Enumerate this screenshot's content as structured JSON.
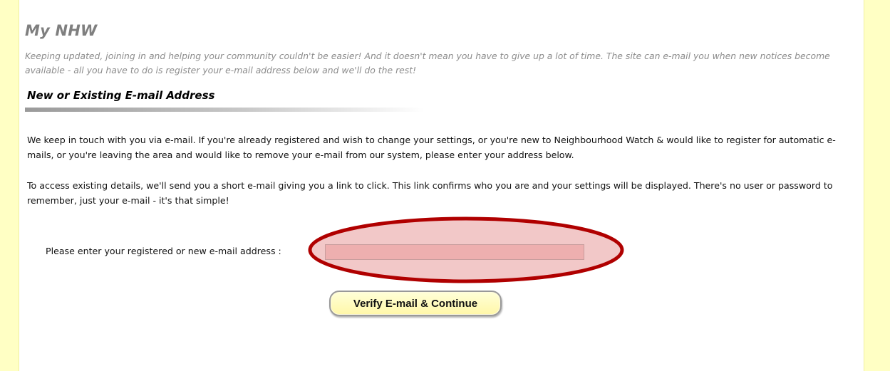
{
  "page": {
    "title": "My NHW",
    "intro": "Keeping updated, joining in and helping your community couldn't be easier! And it doesn't mean you have to give up a lot of time. The site can e-mail you when new notices become available - all you have to do is register your e-mail address below and we'll do the rest!"
  },
  "section": {
    "heading": "New or Existing E-mail Address",
    "paragraph_1": "We keep in touch with you via e-mail. If you're already registered and wish to change your settings, or you're new to Neighbourhood Watch & would like to register for automatic e-mails, or you're leaving the area and would like to remove your e-mail from our system, please enter your address below.",
    "paragraph_2": "To access existing details, we'll send you a short e-mail giving you a link to click. This link confirms who you are and your settings will be displayed. There's no user or password to remember, just your e-mail - it's that simple!"
  },
  "form": {
    "email_label": "Please enter your registered or new e-mail address :",
    "email_value": "",
    "submit_label": "Verify E-mail & Continue"
  },
  "colors": {
    "sidebar": "#ffffc4",
    "highlight_ring": "#b00000",
    "highlight_fill": "#e89a9a"
  }
}
